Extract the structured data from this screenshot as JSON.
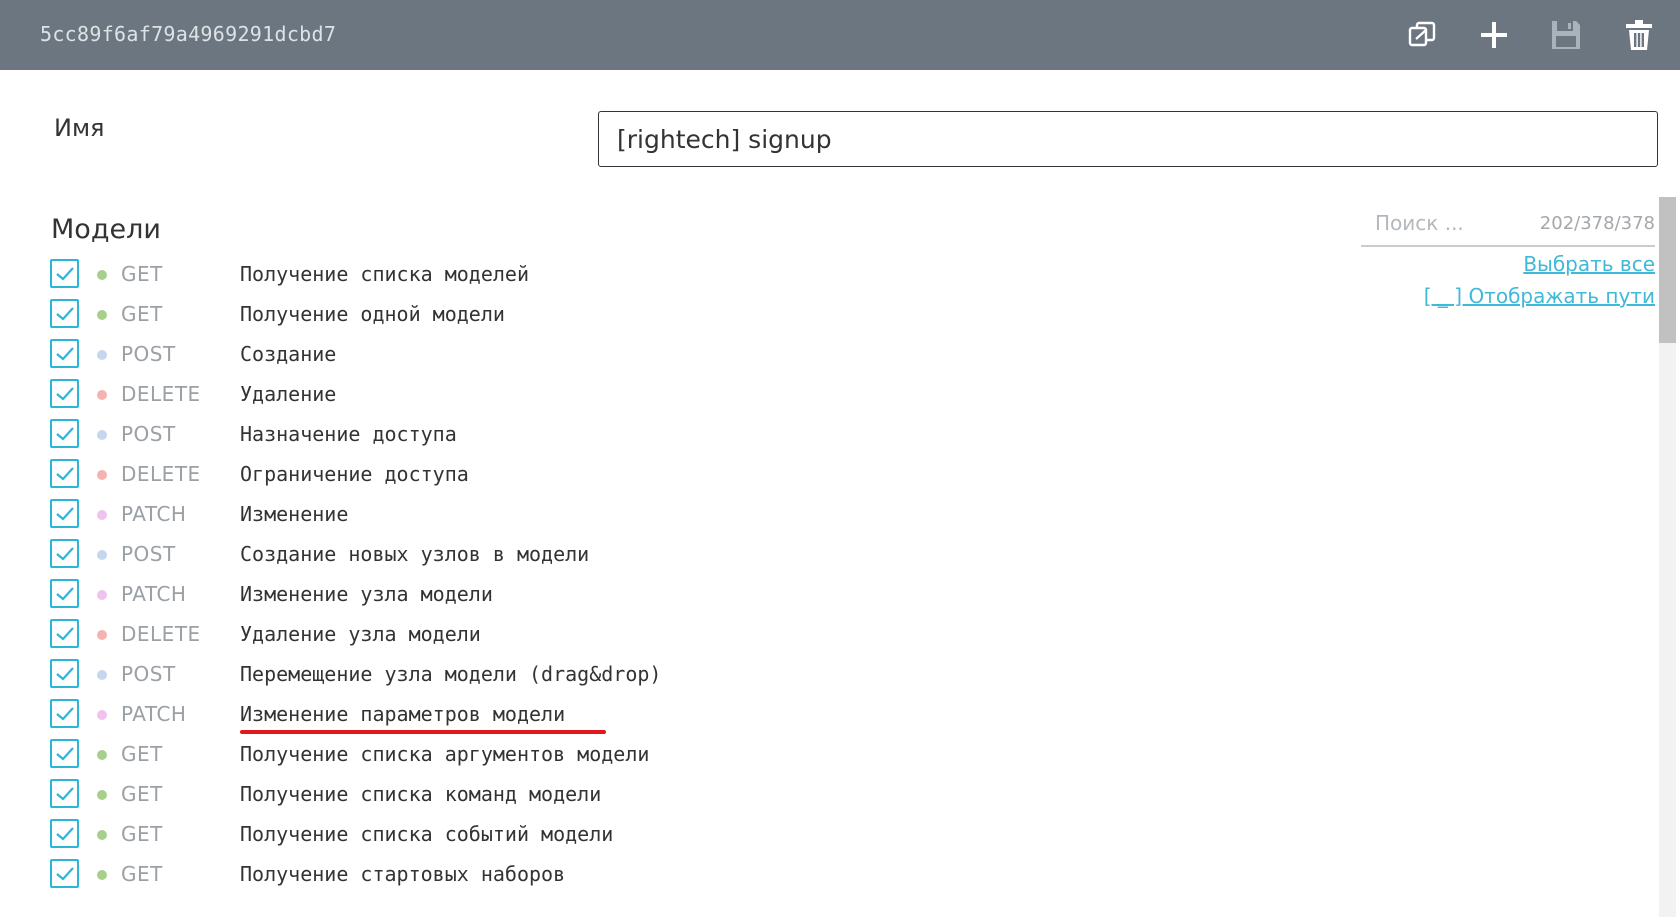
{
  "header": {
    "title": "5cc89f6af79a4969291dcbd7",
    "icons": [
      "copy-icon",
      "plus-icon",
      "save-icon",
      "trash-icon"
    ]
  },
  "form": {
    "name_label": "Имя",
    "name_value": "[rightech] signup"
  },
  "models": {
    "title": "Модели",
    "search_placeholder": "Поиск ...",
    "count": "202/378/378",
    "select_all": "Выбрать все",
    "show_paths": "[ _ ] Отображать пути",
    "method_colors": {
      "GET": "#a8d08d",
      "POST": "#c5d7ef",
      "DELETE": "#f2b3b1",
      "PATCH": "#efc2ef"
    },
    "items": [
      {
        "method": "GET",
        "label": "Получение списка моделей",
        "checked": true
      },
      {
        "method": "GET",
        "label": "Получение одной модели",
        "checked": true
      },
      {
        "method": "POST",
        "label": "Создание",
        "checked": true
      },
      {
        "method": "DELETE",
        "label": "Удаление",
        "checked": true
      },
      {
        "method": "POST",
        "label": "Назначение доступа",
        "checked": true
      },
      {
        "method": "DELETE",
        "label": "Ограничение доступа",
        "checked": true
      },
      {
        "method": "PATCH",
        "label": "Изменение",
        "checked": true
      },
      {
        "method": "POST",
        "label": "Создание новых узлов в модели",
        "checked": true
      },
      {
        "method": "PATCH",
        "label": "Изменение узла модели",
        "checked": true
      },
      {
        "method": "DELETE",
        "label": "Удаление узла модели",
        "checked": true
      },
      {
        "method": "POST",
        "label": "Перемещение узла модели (drag&drop)",
        "checked": true
      },
      {
        "method": "PATCH",
        "label": "Изменение параметров модели",
        "checked": true
      },
      {
        "method": "GET",
        "label": "Получение списка аргументов модели",
        "checked": true
      },
      {
        "method": "GET",
        "label": "Получение списка команд модели",
        "checked": true
      },
      {
        "method": "GET",
        "label": "Получение списка событий модели",
        "checked": true
      },
      {
        "method": "GET",
        "label": "Получение стартовых наборов",
        "checked": true
      }
    ]
  }
}
